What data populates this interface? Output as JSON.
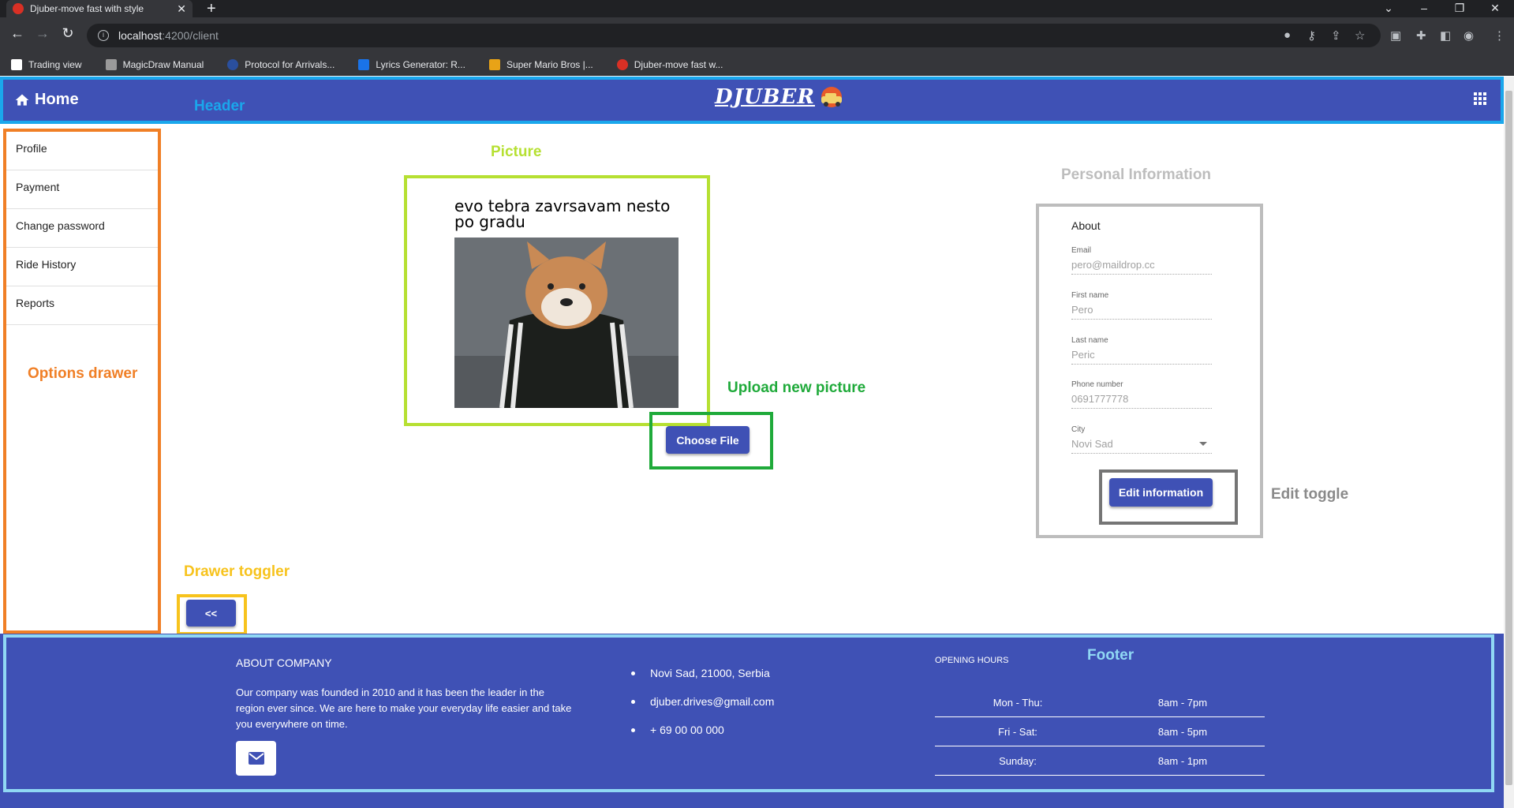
{
  "browser": {
    "tab_title": "Djuber-move fast with style",
    "new_tab": "+",
    "url_host": "localhost",
    "url_path": ":4200/client",
    "bookmarks": [
      {
        "label": "Trading view",
        "color": "#1e1e1e"
      },
      {
        "label": "MagicDraw Manual",
        "color": "#6b6b6b"
      },
      {
        "label": "Protocol for Arrivals...",
        "color": "#2a4f9e"
      },
      {
        "label": "Lyrics Generator: R...",
        "color": "#1a73e8"
      },
      {
        "label": "Super Mario Bros |...",
        "color": "#e8a317"
      },
      {
        "label": "Djuber-move fast w...",
        "color": "#d93025"
      }
    ]
  },
  "header": {
    "home_label": "Home",
    "logo_text": "DJUBER"
  },
  "annotations": {
    "header": "Header",
    "picture": "Picture",
    "personal_information": "Personal Information",
    "options_drawer": "Options drawer",
    "upload_new_picture": "Upload new picture",
    "edit_toggle": "Edit toggle",
    "drawer_toggler": "Drawer toggler",
    "footer": "Footer"
  },
  "drawer": {
    "items": [
      "Profile",
      "Payment",
      "Change password",
      "Ride History",
      "Reports"
    ]
  },
  "picture": {
    "caption": "evo tebra zavrsavam nesto po gradu"
  },
  "upload": {
    "button_label": "Choose File"
  },
  "about": {
    "title": "About",
    "email_label": "Email",
    "email_value": "pero@maildrop.cc",
    "first_name_label": "First name",
    "first_name_value": "Pero",
    "last_name_label": "Last name",
    "last_name_value": "Peric",
    "phone_label": "Phone number",
    "phone_value": "0691777778",
    "city_label": "City",
    "city_value": "Novi Sad",
    "edit_button": "Edit information"
  },
  "toggler": {
    "label": "<<"
  },
  "footer": {
    "about_heading": "ABOUT COMPANY",
    "about_text": "Our company was founded in 2010 and it has been the leader in the region ever since. We are here to make your everyday life easier and take you everywhere on time.",
    "contacts": [
      "Novi Sad, 21000, Serbia",
      "djuber.drives@gmail.com",
      "+ 69 00 00 000"
    ],
    "hours_heading": "OPENING HOURS",
    "hours": [
      {
        "day": "Mon - Thu:",
        "time": "8am - 7pm"
      },
      {
        "day": "Fri - Sat:",
        "time": "8am - 5pm"
      },
      {
        "day": "Sunday:",
        "time": "8am - 1pm"
      }
    ]
  },
  "colors": {
    "primary": "#3f51b5",
    "header_frame": "#1aa7ec",
    "drawer_frame": "#f07f26",
    "picture_frame": "#b6e032",
    "upload_frame": "#1faa3a",
    "info_frame": "#bdbdbd",
    "edit_frame": "#757575",
    "toggler_frame": "#f7c31d",
    "footer_frame": "#90d8f4"
  }
}
